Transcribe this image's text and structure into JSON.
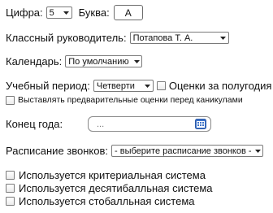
{
  "digit": {
    "label": "Цифра:",
    "value": "5"
  },
  "letter": {
    "label": "Буква:",
    "value": "А"
  },
  "teacher": {
    "label": "Классный руководитель:",
    "value": "Потапова Т. А."
  },
  "calendar": {
    "label": "Календарь:",
    "value": "По умолчанию"
  },
  "study_period": {
    "label": "Учебный период:",
    "value": "Четверти",
    "half_year_label": "Оценки за полугодия"
  },
  "preliminary_grades": {
    "label": "Выставлять предварительные оценки перед каникулами"
  },
  "year_end": {
    "label": "Конец года:",
    "placeholder": "..."
  },
  "bell_schedule": {
    "label": "Расписание звонков:",
    "value": "- выберите расписание звонков -"
  },
  "grading_systems": [
    {
      "label": "Используется критериальная система"
    },
    {
      "label": "Используется десятибалльная система"
    },
    {
      "label": "Используется стобалльная система"
    }
  ]
}
